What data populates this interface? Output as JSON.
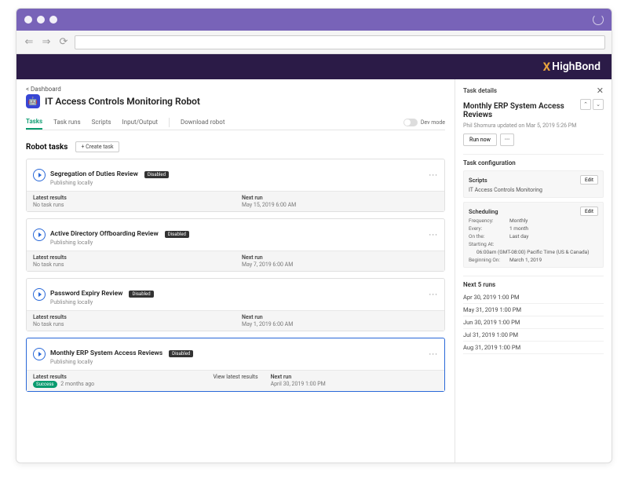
{
  "brand": {
    "prefix": "X",
    "name": "HighBond"
  },
  "breadcrumb": "< Dashboard",
  "page_title": "IT Access Controls Monitoring Robot",
  "tabs": {
    "tasks": "Tasks",
    "task_runs": "Task runs",
    "scripts": "Scripts",
    "input_output": "Input/Output",
    "download": "Download robot"
  },
  "dev_mode_label": "Dev mode",
  "section": {
    "title": "Robot tasks",
    "create": "+ Create task"
  },
  "col": {
    "latest": "Latest results",
    "next": "Next run",
    "view": "View latest results"
  },
  "badges": {
    "disabled": "Disabled",
    "success": "Success"
  },
  "publishing": "Publishing locally",
  "tasks_list": [
    {
      "name": "Segregation of Duties Review",
      "latest": "No task runs",
      "next": "May 15, 2019 6:00 AM",
      "success": false
    },
    {
      "name": "Active Directory Offboarding Review",
      "latest": "No task runs",
      "next": "May 7, 2019 6:00 AM",
      "success": false
    },
    {
      "name": "Password Expiry Review",
      "latest": "No task runs",
      "next": "May 1, 2019 6:00 AM",
      "success": false
    },
    {
      "name": "Monthly ERP System Access Reviews",
      "latest": "2 months ago",
      "next": "April 30, 2019 1:00 PM",
      "success": true
    }
  ],
  "details": {
    "header": "Task details",
    "title": "Monthly ERP System Access Reviews",
    "meta": "Phil Shomura  updated on  Mar 5, 2019 5:26 PM",
    "run_now": "Run now",
    "config_title": "Task configuration",
    "scripts_label": "Scripts",
    "scripts_val": "IT Access Controls Monitoring",
    "edit": "Edit",
    "scheduling_label": "Scheduling",
    "schedule": {
      "frequency_k": "Frequency:",
      "frequency_v": "Monthly",
      "every_k": "Every:",
      "every_v": "1 month",
      "on_k": "On the:",
      "on_v": "Last day",
      "starting_k": "Starting At:",
      "starting_v": "06:00am (GMT-08:00) Pacific Time (US & Canada)",
      "beginning_k": "Beginning On:",
      "beginning_v": "March 1, 2019"
    },
    "next_runs_title": "Next 5 runs",
    "next_runs": [
      "Apr 30, 2019 1:00 PM",
      "May 31, 2019 1:00 PM",
      "Jun 30, 2019 1:00 PM",
      "Jul 31, 2019 1:00 PM",
      "Aug 31, 2019 1:00 PM"
    ]
  }
}
